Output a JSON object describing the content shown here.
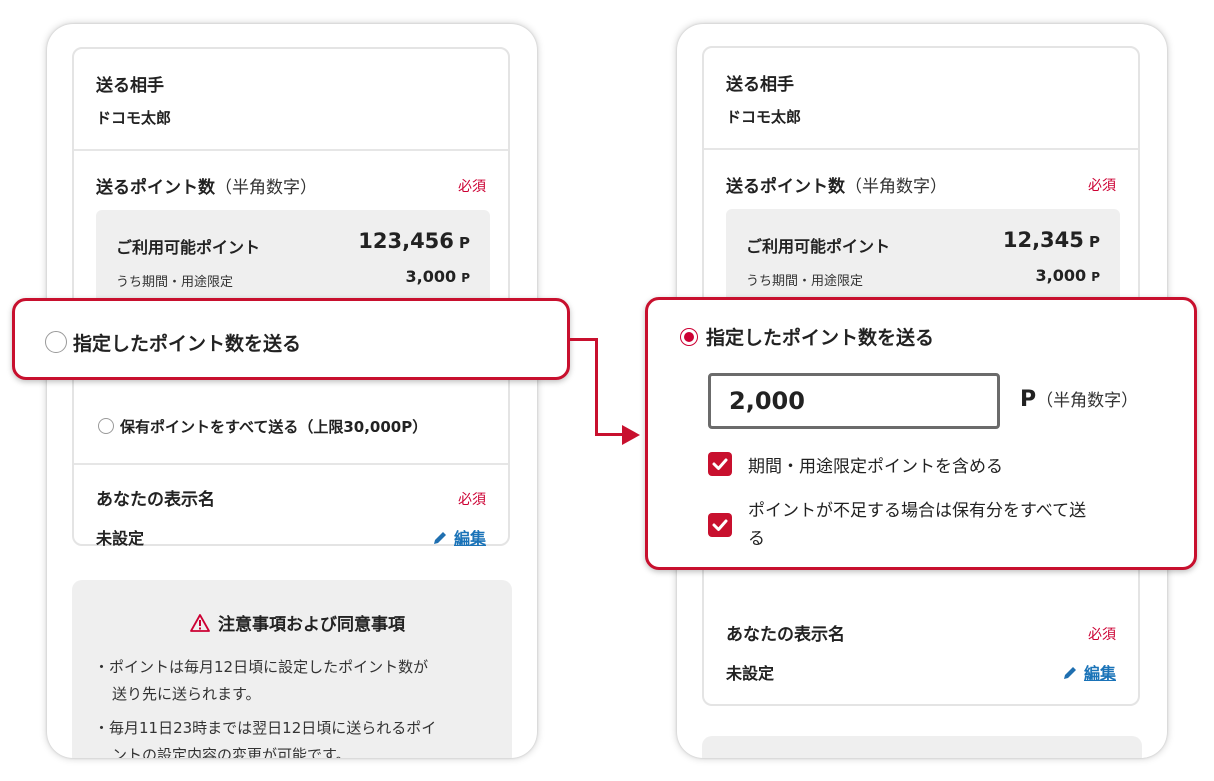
{
  "left_screen": {
    "recipient_label": "送る相手",
    "recipient_name": "ドコモ太郎",
    "points_label": "送るポイント数",
    "points_note": "（半角数字）",
    "required": "必須",
    "available_label": "ご利用可能ポイント",
    "available_value": "123,456",
    "available_unit": "P",
    "limited_label": "うち期間・用途限定",
    "limited_value": "3,000",
    "limited_unit": "P",
    "option_specified": "指定したポイント数を送る",
    "option_all": "保有ポイントをすべて送る（上限30,000P）",
    "display_name_label": "あなたの表示名",
    "display_name_required": "必須",
    "display_name_value": "未設定",
    "edit_label": "編集",
    "notice_title": "注意事項および同意事項",
    "notice_lines": [
      "・ポイントは毎月12日頃に設定したポイント数が",
      "送り先に送られます。",
      "・毎月11日23時までは翌日12日頃に送られるポイ",
      "ントの設定内容の変更が可能です。"
    ]
  },
  "right_screen": {
    "recipient_label": "送る相手",
    "recipient_name": "ドコモ太郎",
    "points_label": "送るポイント数",
    "points_note": "（半角数字）",
    "required": "必須",
    "available_label": "ご利用可能ポイント",
    "available_value": "12,345",
    "available_unit": "P",
    "limited_label": "うち期間・用途限定",
    "limited_value": "3,000",
    "limited_unit": "P",
    "option_specified": "指定したポイント数を送る",
    "amount_value": "2,000",
    "amount_unit": "P",
    "amount_note": "（半角数字）",
    "check_include_limited": "期間・用途限定ポイントを含める",
    "check_send_all_line1": "ポイントが不足する場合は保有分をすべて送",
    "check_send_all_line2": "る",
    "display_name_label": "あなたの表示名",
    "display_name_required": "必須",
    "display_name_value": "未設定",
    "edit_label": "編集"
  },
  "colors": {
    "accent": "#c8102e",
    "required": "#cc0033",
    "link": "#1a73b8"
  }
}
